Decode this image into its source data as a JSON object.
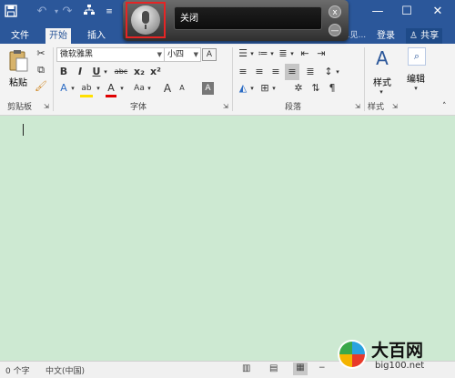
{
  "window": {
    "minimize": "—",
    "maximize": "☐",
    "close": "✕"
  },
  "quick_access": [
    "save-icon",
    "undo-icon",
    "redo-icon",
    "tree-icon",
    "more-icon"
  ],
  "tabs": [
    {
      "label": "文件",
      "active": false
    },
    {
      "label": "开始",
      "active": true
    },
    {
      "label": "插入",
      "active": false
    },
    {
      "label": "...见...",
      "active": false
    }
  ],
  "tab_right": {
    "login": "登录",
    "share": "共享"
  },
  "voice": {
    "status": "关闭",
    "close": "x",
    "minimize": "—"
  },
  "ribbon": {
    "paste_label": "粘贴",
    "font_name": "微软雅黑",
    "font_size": "小四",
    "style_label": "样式",
    "edit_label": "编辑",
    "groups": {
      "clipboard": "剪贴板",
      "font": "字体",
      "paragraph": "段落",
      "style": "样式"
    },
    "font_buttons": {
      "bold": "B",
      "italic": "I",
      "underline": "U",
      "strike": "abc",
      "sub": "x₂",
      "sup": "x²",
      "grow": "A",
      "shrink": "A",
      "case": "Aa",
      "clear": "A",
      "effect": "A",
      "highlight": "ab",
      "color": "A"
    }
  },
  "statusbar": {
    "words": "0 个字",
    "language": "中文(中国)"
  },
  "watermark": {
    "logo_text": "大百网",
    "url": "big100.net"
  },
  "colors": {
    "brand": "#2b579a",
    "doc_background": "#cde9d2",
    "mic_highlight": "#e52525"
  }
}
